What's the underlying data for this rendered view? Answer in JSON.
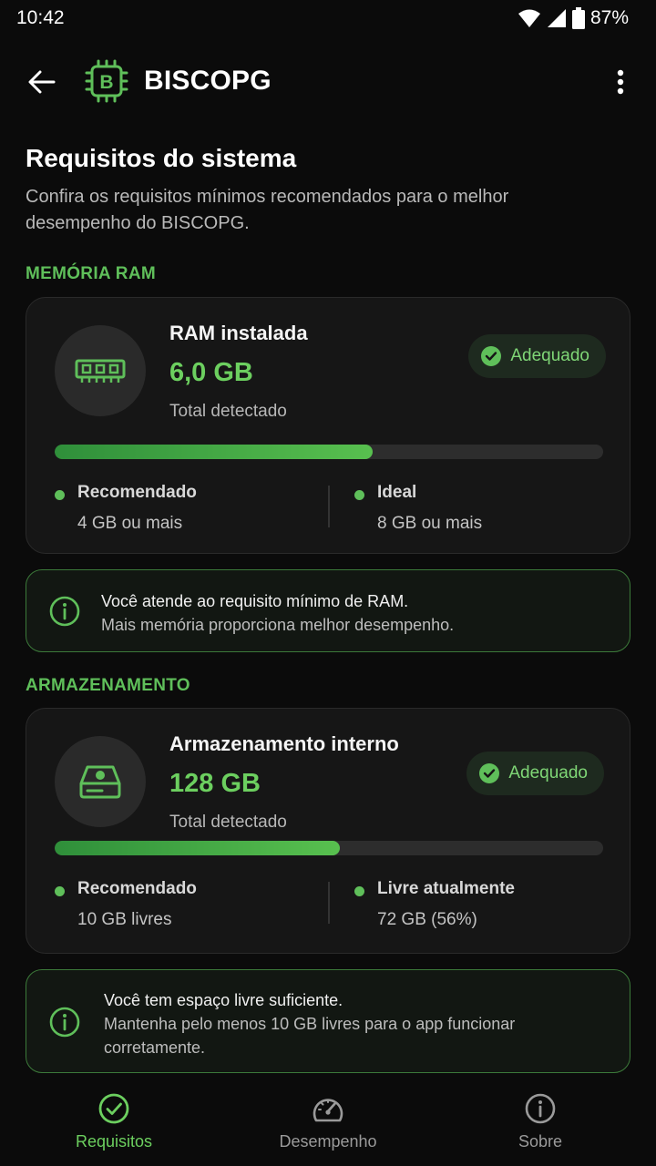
{
  "status_bar": {
    "time": "10:42",
    "battery": "87%"
  },
  "app_bar": {
    "title": "BISCOPG",
    "logo_letter": "B"
  },
  "page": {
    "title": "Requisitos do sistema",
    "description": "Confira os requisitos mínimos recomendados para o melhor desempenho do BISCOPG."
  },
  "ram": {
    "section_label": "MEMÓRIA RAM",
    "card_title": "RAM instalada",
    "value": "6,0 GB",
    "subtitle": "Total detectado",
    "badge": "Adequado",
    "progress_fraction": 0.58,
    "stats": [
      {
        "label": "Recomendado",
        "value": "4 GB ou mais"
      },
      {
        "label": "Ideal",
        "value": "8 GB ou mais"
      }
    ],
    "info_line1": "Você atende ao requisito mínimo de RAM.",
    "info_line2": "Mais memória proporciona melhor desempenho."
  },
  "storage": {
    "section_label": "ARMAZENAMENTO",
    "card_title": "Armazenamento interno",
    "value": "128 GB",
    "subtitle": "Total detectado",
    "badge": "Adequado",
    "progress_fraction": 0.52,
    "stats": [
      {
        "label": "Recomendado",
        "value": "10 GB livres"
      },
      {
        "label": "Livre atualmente",
        "value": "72 GB (56%)"
      }
    ],
    "info_line1": "Você tem espaço livre suficiente.",
    "info_line2": "Mantenha pelo menos 10 GB livres para o app funcionar corretamente."
  },
  "bottom_nav": {
    "items": [
      {
        "label": "Requisitos",
        "icon": "check-circle-icon",
        "active": true
      },
      {
        "label": "Desempenho",
        "icon": "speedometer-icon",
        "active": false
      },
      {
        "label": "Sobre",
        "icon": "info-icon",
        "active": false
      }
    ]
  },
  "colors": {
    "accent": "#5fbf5a",
    "background": "#0b0b0b",
    "card": "#161616"
  }
}
